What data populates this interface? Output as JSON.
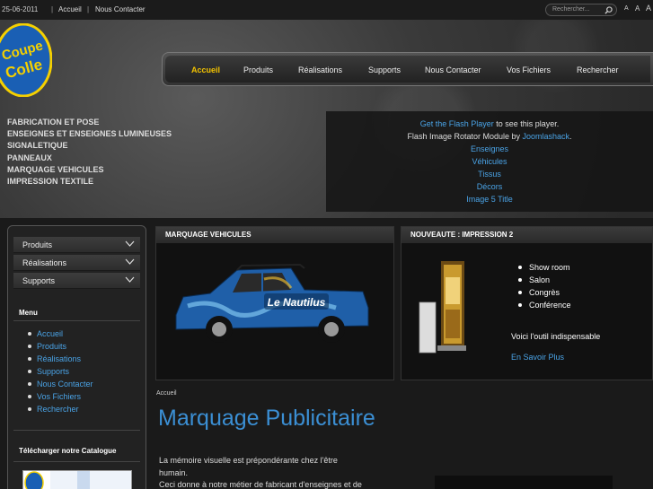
{
  "topbar": {
    "date": "25-06-2011",
    "links": [
      "Accueil",
      "Nous Contacter"
    ],
    "search_placeholder": "Rechercher...",
    "font_sizer": [
      "A",
      "A",
      "A"
    ]
  },
  "logo": {
    "text_top": "Coupe",
    "text_bottom": "Colle"
  },
  "mainnav": {
    "items": [
      "Accueil",
      "Produits",
      "Réalisations",
      "Supports",
      "Nous Contacter",
      "Vos Fichiers",
      "Rechercher"
    ],
    "active": "Accueil"
  },
  "categories": [
    "FABRICATION ET POSE",
    "ENSEIGNES ET ENSEIGNES LUMINEUSES",
    "SIGNALETIQUE",
    "PANNEAUX",
    "MARQUAGE VEHICULES",
    "IMPRESSION TEXTILE"
  ],
  "flash": {
    "get_flash_link": "Get the Flash Player",
    "get_flash_rest": " to see this player.",
    "module_text": "Flash Image Rotator Module by ",
    "module_link": "Joomlashack",
    "module_end": ".",
    "links": [
      "Enseignes",
      "Véhicules",
      "Tissus",
      "Décors",
      "Image 5 Title"
    ]
  },
  "sidebar": {
    "items": [
      "Produits",
      "Réalisations",
      "Supports"
    ],
    "menu_title": "Menu",
    "menu": [
      "Accueil",
      "Produits",
      "Réalisations",
      "Supports",
      "Nous Contacter",
      "Vos Fichiers",
      "Rechercher"
    ],
    "catalog_title": "Télécharger notre Catalogue"
  },
  "panel_vehicles": {
    "title": "MARQUAGE VEHICULES",
    "car_brand_text": "Le Nautilus"
  },
  "panel_news": {
    "title": "NOUVEAUTE : IMPRESSION 2",
    "list": [
      "Show room",
      "Salon",
      "Congrès",
      "Conférence"
    ],
    "tagline": "Voici l'outil indispensable",
    "link": "En Savoir Plus"
  },
  "main": {
    "breadcrumb": "Accueil",
    "title": "Marquage Publicitaire",
    "paragraph_lines": [
      "La mémoire visuelle est prépondérante chez l'être",
      "humain.",
      "Ceci donne à notre métier de fabricant d'enseignes et de"
    ]
  },
  "colors": {
    "accent_link": "#4aa3e6",
    "nav_active": "#f2c200",
    "title_blue": "#3b8fd4",
    "logo_yellow": "#f5d000",
    "logo_blue": "#1a5fb4"
  }
}
